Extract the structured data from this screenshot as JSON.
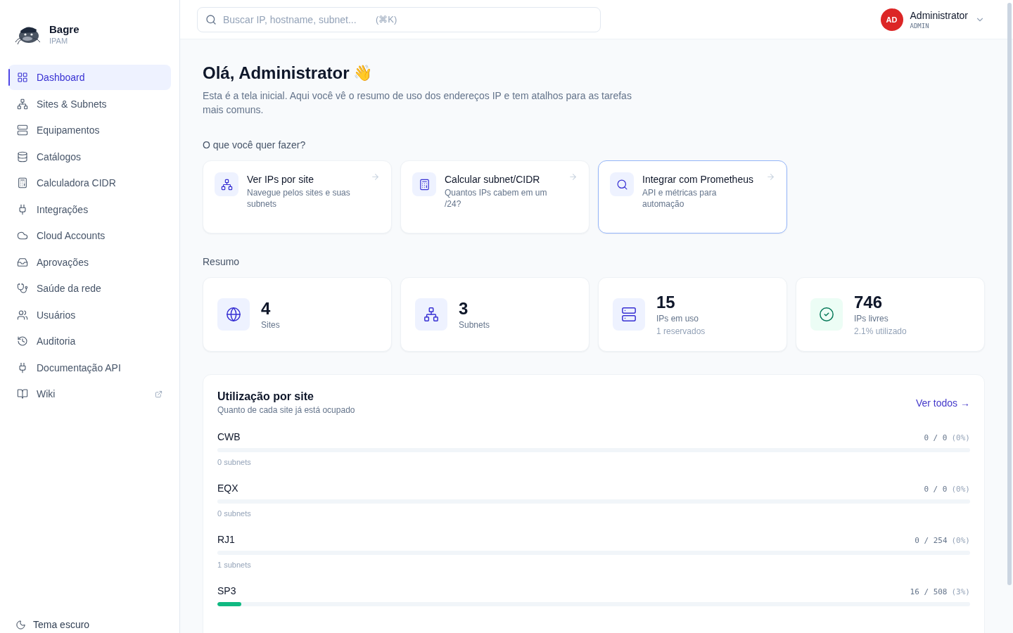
{
  "brand": {
    "name": "Bagre",
    "subtitle": "IPAM"
  },
  "sidebar": {
    "items": [
      {
        "label": "Dashboard",
        "selected": true
      },
      {
        "label": "Sites & Subnets",
        "selected": false
      },
      {
        "label": "Equipamentos",
        "selected": false
      },
      {
        "label": "Catálogos",
        "selected": false
      },
      {
        "label": "Calculadora CIDR",
        "selected": false
      },
      {
        "label": "Integrações",
        "selected": false
      },
      {
        "label": "Cloud Accounts",
        "selected": false
      },
      {
        "label": "Aprovações",
        "selected": false
      },
      {
        "label": "Saúde da rede",
        "selected": false
      },
      {
        "label": "Usuários",
        "selected": false
      },
      {
        "label": "Auditoria",
        "selected": false
      },
      {
        "label": "Documentação API",
        "selected": false
      },
      {
        "label": "Wiki",
        "selected": false,
        "external": true
      }
    ],
    "theme_toggle": "Tema escuro"
  },
  "search": {
    "placeholder": "Buscar IP, hostname, subnet...",
    "shortcut": "(⌘K)"
  },
  "user": {
    "initials": "AD",
    "name": "Administrator",
    "role": "ADMIN"
  },
  "greeting": {
    "title": "Olá, Administrator",
    "emoji": "👋",
    "description": "Esta é a tela inicial. Aqui você vê o resumo de uso dos endereços IP e tem atalhos para as tarefas mais comuns."
  },
  "actions": {
    "heading": "O que você quer fazer?",
    "items": [
      {
        "title": "Ver IPs por site",
        "subtitle": "Navegue pelos sites e suas subnets",
        "selected": false
      },
      {
        "title": "Calcular subnet/CIDR",
        "subtitle": "Quantos IPs cabem em um /24?",
        "selected": false
      },
      {
        "title": "Integrar com Prometheus",
        "subtitle": "API e métricas para automação",
        "selected": true
      }
    ]
  },
  "summary": {
    "heading": "Resumo",
    "stats": [
      {
        "value": "4",
        "label": "Sites",
        "kind": "default"
      },
      {
        "value": "3",
        "label": "Subnets",
        "kind": "default"
      },
      {
        "value": "15",
        "label": "IPs em uso",
        "note": "1 reservados",
        "kind": "default"
      },
      {
        "value": "746",
        "label": "IPs livres",
        "note": "2.1% utilizado",
        "kind": "success"
      }
    ]
  },
  "utilization": {
    "title": "Utilização por site",
    "subtitle": "Quanto de cada site já está ocupado",
    "link": "Ver todos →",
    "sites": [
      {
        "name": "CWB",
        "reading": "0 / 0",
        "percent": "(0%)",
        "level": 0,
        "subnets": "0 subnets"
      },
      {
        "name": "EQX",
        "reading": "0 / 0",
        "percent": "(0%)",
        "level": 0,
        "subnets": "0 subnets"
      },
      {
        "name": "RJ1",
        "reading": "0 / 254",
        "percent": "(0%)",
        "level": 0,
        "subnets": "1 subnets"
      },
      {
        "name": "SP3",
        "reading": "16 / 508",
        "percent": "(3%)",
        "level": 0.032
      }
    ]
  }
}
